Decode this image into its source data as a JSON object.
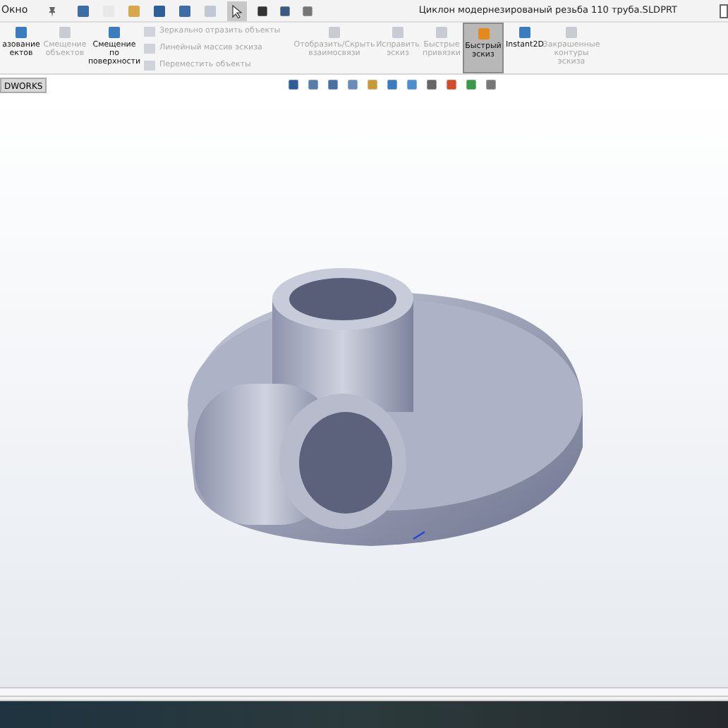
{
  "menu": {
    "label": "Окно"
  },
  "title": "Циклон модернезированый резьба 110 труба.SLDPRT",
  "ribbon": [
    {
      "kind": "large",
      "label": "азование ектов",
      "disabled": false,
      "selected": false
    },
    {
      "kind": "large",
      "label": "Смещение объектов",
      "disabled": true,
      "selected": false
    },
    {
      "kind": "large",
      "label": "Смещение по поверхности",
      "disabled": false,
      "selected": false
    },
    {
      "kind": "stack",
      "items": [
        {
          "label": "Зеркально отразить объекты",
          "disabled": true
        },
        {
          "label": "Линейный массив эскиза",
          "disabled": true
        },
        {
          "label": "Переместить объекты",
          "disabled": true
        }
      ]
    },
    {
      "kind": "large",
      "label": "Отобразить/Скрыть взаимосвязи",
      "disabled": true,
      "selected": false
    },
    {
      "kind": "large",
      "label": "Исправить эскиз",
      "disabled": true,
      "selected": false
    },
    {
      "kind": "large",
      "label": "Быстрые привязки",
      "disabled": true,
      "selected": false
    },
    {
      "kind": "large",
      "label": "Быстрый эскиз",
      "disabled": false,
      "selected": true
    },
    {
      "kind": "large",
      "label": "Instant2D",
      "disabled": false,
      "selected": false
    },
    {
      "kind": "large",
      "label": "Закрашенные контуры эскиза",
      "disabled": true,
      "selected": false
    }
  ],
  "tab": {
    "label": "DWORKS"
  }
}
